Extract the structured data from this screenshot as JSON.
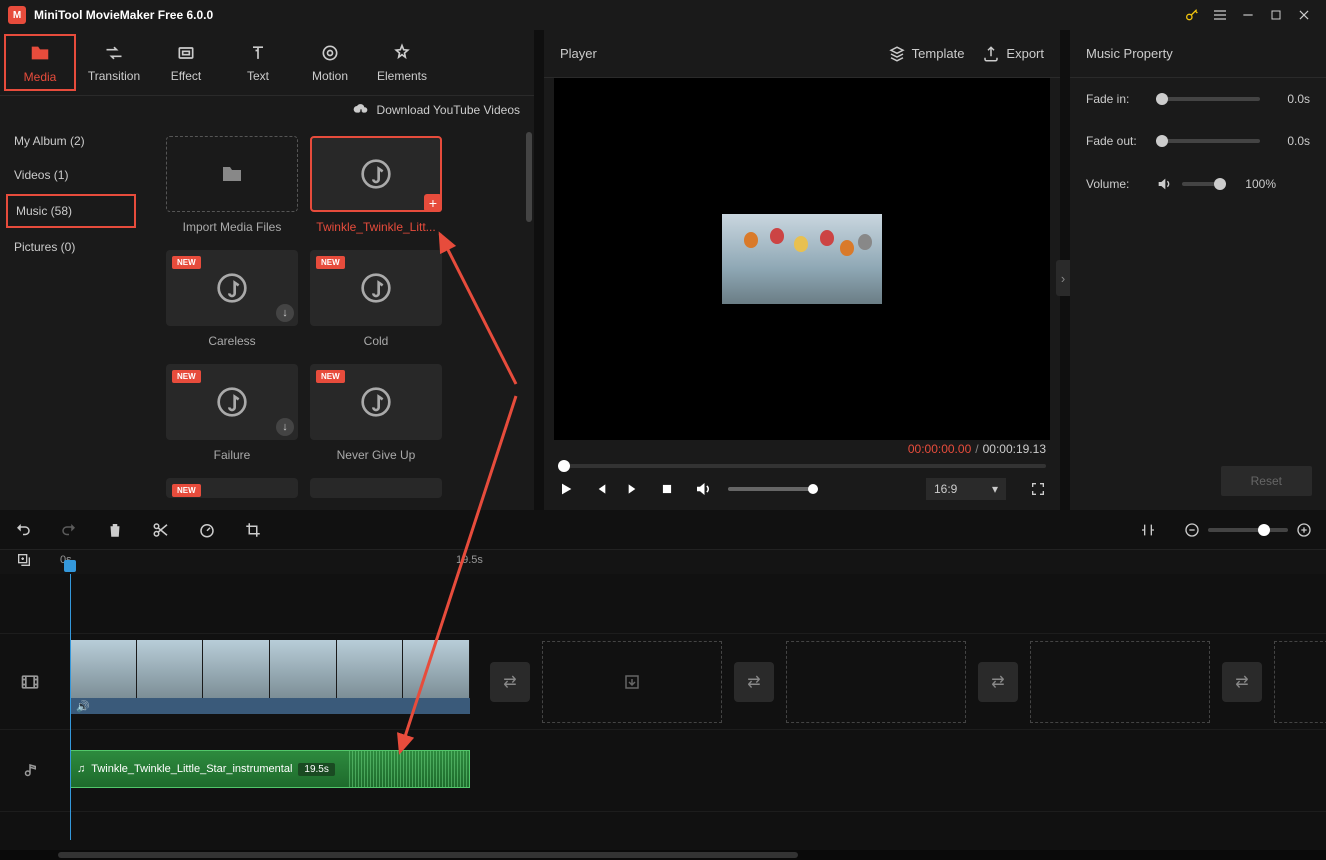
{
  "app": {
    "title": "MiniTool MovieMaker Free 6.0.0"
  },
  "toptabs": {
    "media": "Media",
    "transition": "Transition",
    "effect": "Effect",
    "text": "Text",
    "motion": "Motion",
    "elements": "Elements"
  },
  "sidebar": {
    "my_album": "My Album (2)",
    "videos": "Videos (1)",
    "music": "Music (58)",
    "pictures": "Pictures (0)"
  },
  "dl_label": "Download YouTube Videos",
  "cards": {
    "import": "Import Media Files",
    "twinkle": "Twinkle_Twinkle_Litt...",
    "careless": "Careless",
    "cold": "Cold",
    "failure": "Failure",
    "never": "Never Give Up",
    "new_badge": "NEW"
  },
  "player": {
    "title": "Player",
    "template": "Template",
    "export": "Export",
    "time_current": "00:00:00.00",
    "time_duration": "00:00:19.13",
    "aspect": "16:9"
  },
  "props": {
    "title": "Music Property",
    "fade_in": "Fade in:",
    "fade_in_val": "0.0s",
    "fade_out": "Fade out:",
    "fade_out_val": "0.0s",
    "volume": "Volume:",
    "volume_val": "100%",
    "reset": "Reset"
  },
  "ruler": {
    "t0": "0s",
    "t1": "19.5s"
  },
  "timeline": {
    "audio_clip_name": "Twinkle_Twinkle_Little_Star_instrumental",
    "audio_clip_dur": "19.5s"
  }
}
